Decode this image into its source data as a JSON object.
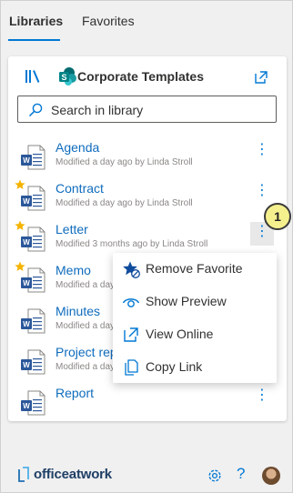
{
  "tabs": [
    {
      "label": "Libraries",
      "active": true
    },
    {
      "label": "Favorites",
      "active": false
    }
  ],
  "library": {
    "title": "Corporate Templates",
    "icon": "sharepoint-icon",
    "search_placeholder": "Search in library"
  },
  "documents": [
    {
      "title": "Agenda",
      "meta": "Modified a day ago by Linda Stroll",
      "favorite": false
    },
    {
      "title": "Contract",
      "meta": "Modified a day ago by Linda Stroll",
      "favorite": true
    },
    {
      "title": "Letter",
      "meta": "Modified 3 months ago by Linda Stroll",
      "favorite": true,
      "menu_open": true
    },
    {
      "title": "Memo",
      "meta": "Modified a day ago by Linda Stroll",
      "favorite": true
    },
    {
      "title": "Minutes",
      "meta": "Modified a day ago by Linda Stroll",
      "favorite": false
    },
    {
      "title": "Project rep",
      "meta": "Modified a day ago by Linda Stroll",
      "favorite": false
    },
    {
      "title": "Report",
      "meta": "Modified a day ago by Linda Stroll",
      "favorite": false
    }
  ],
  "context_menu": {
    "items": [
      {
        "label": "Remove Favorite",
        "icon": "star-remove-icon"
      },
      {
        "label": "Show Preview",
        "icon": "eye-icon"
      },
      {
        "label": "View Online",
        "icon": "open-external-icon"
      },
      {
        "label": "Copy Link",
        "icon": "copy-icon"
      }
    ]
  },
  "step_badge": "1",
  "footer": {
    "brand": "officeatwork",
    "icons": [
      "settings-icon",
      "help-icon",
      "avatar"
    ]
  },
  "colors": {
    "accent": "#0078d4",
    "link": "#0f6cbd",
    "star": "#f4b400",
    "word": "#2b579a",
    "badge": "#f5f08e"
  }
}
